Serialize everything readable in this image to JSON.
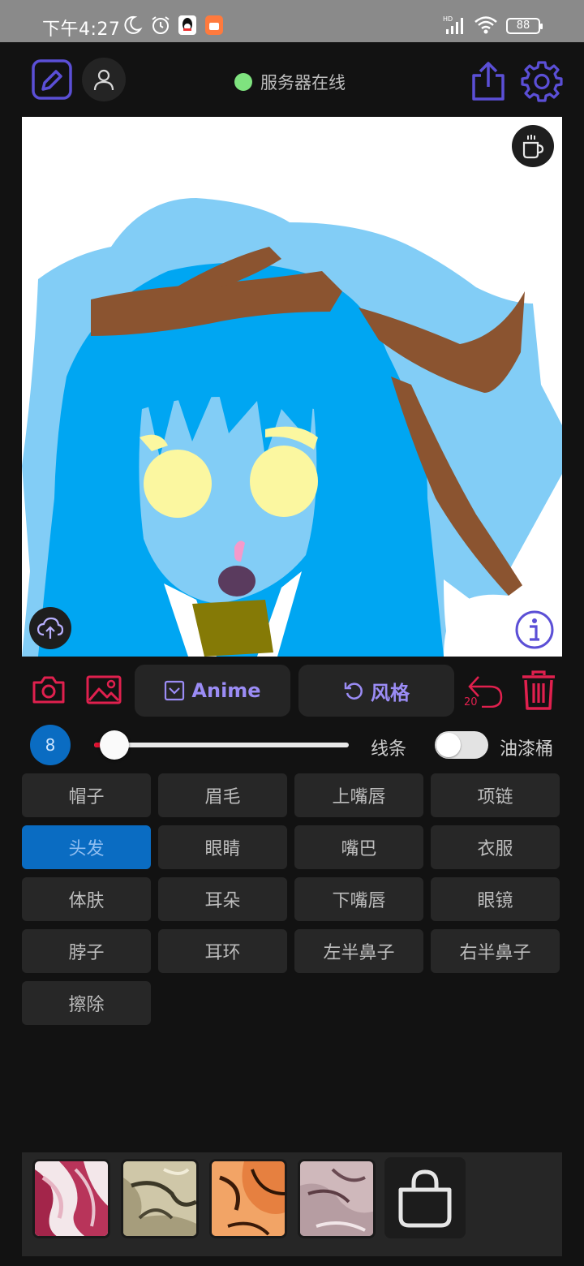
{
  "status_bar": {
    "time": "下午4:27",
    "battery": "88",
    "icons": [
      "moon-icon",
      "alarm-icon",
      "qq-icon",
      "app-notification-icon",
      "hd-signal-icon",
      "wifi-icon"
    ]
  },
  "header": {
    "server_status": "服务器在线",
    "status_color": "#7fe37f",
    "icons": [
      "edit-icon",
      "user-icon",
      "share-icon",
      "settings-icon"
    ]
  },
  "canvas": {
    "icons": [
      "coffee-icon",
      "cloud-upload-icon",
      "info-icon"
    ]
  },
  "toolbar": {
    "anime_label": "Anime",
    "style_label": "风格",
    "undo_count": "20",
    "icons": [
      "camera-icon",
      "image-icon",
      "mail-icon",
      "refresh-icon",
      "undo-icon",
      "trash-icon"
    ]
  },
  "brush": {
    "size": "8",
    "slider_fraction": 0.08,
    "line_label": "线条",
    "paint_bucket_label": "油漆桶",
    "paint_bucket_on": false
  },
  "parts": [
    {
      "label": "帽子",
      "active": false
    },
    {
      "label": "眉毛",
      "active": false
    },
    {
      "label": "上嘴唇",
      "active": false
    },
    {
      "label": "项链",
      "active": false
    },
    {
      "label": "头发",
      "active": true
    },
    {
      "label": "眼睛",
      "active": false
    },
    {
      "label": "嘴巴",
      "active": false
    },
    {
      "label": "衣服",
      "active": false
    },
    {
      "label": "体肤",
      "active": false
    },
    {
      "label": "耳朵",
      "active": false
    },
    {
      "label": "下嘴唇",
      "active": false
    },
    {
      "label": "眼镜",
      "active": false
    },
    {
      "label": "脖子",
      "active": false
    },
    {
      "label": "耳环",
      "active": false
    },
    {
      "label": "左半鼻子",
      "active": false
    },
    {
      "label": "右半鼻子",
      "active": false
    },
    {
      "label": "擦除",
      "active": false
    }
  ],
  "colors": {
    "accent": "#5b4fd6",
    "danger": "#e0204e",
    "selected": "#0a6cc2",
    "hair": "#00a6f2",
    "skin": "#82cdf6",
    "hat": "#8b5430",
    "eyes": "#fbf7a0"
  },
  "styles": {
    "thumbnails": [
      "style-thumbnail-1",
      "style-thumbnail-2",
      "style-thumbnail-3",
      "style-thumbnail-4"
    ],
    "shop_icon": "shopping-bag-icon"
  }
}
